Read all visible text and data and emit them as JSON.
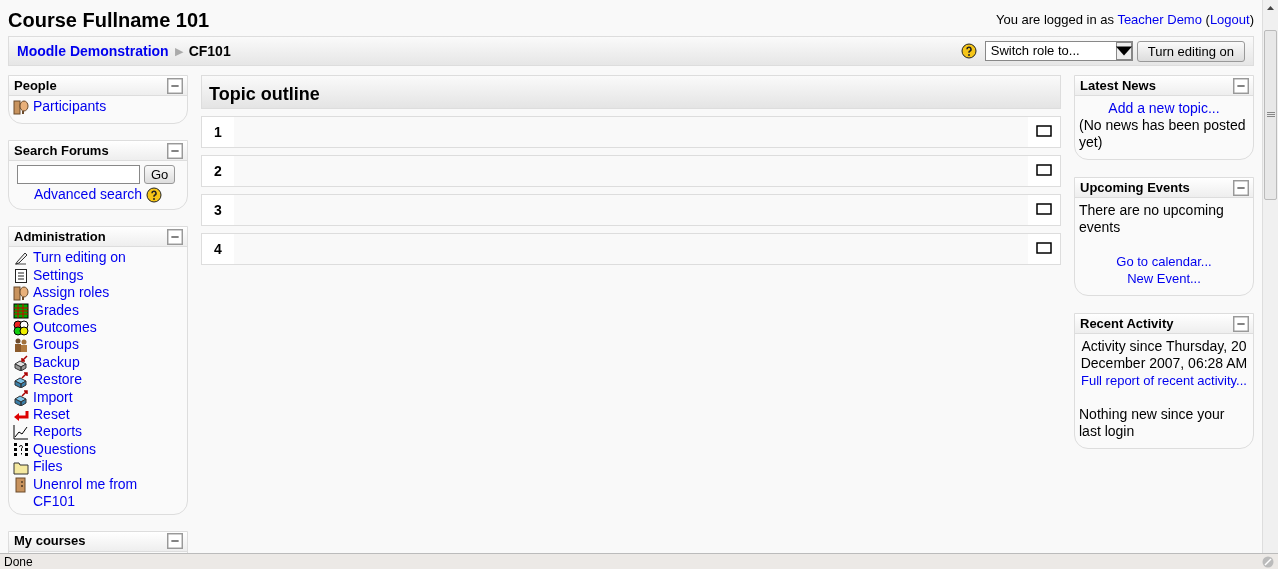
{
  "header": {
    "title": "Course Fullname 101",
    "login_prefix": "You are logged in as",
    "user": "Teacher Demo",
    "logout_open": "(",
    "logout": "Logout",
    "logout_close": ")"
  },
  "navbar": {
    "breadcrumb": [
      {
        "label": "Moodle Demonstration",
        "link": true
      },
      {
        "label": "CF101",
        "link": false
      }
    ],
    "separator": "▶",
    "role_select": "Switch role to...",
    "edit_button": "Turn editing on"
  },
  "left_blocks": [
    {
      "title": "People",
      "items": [
        {
          "label": "Participants"
        }
      ]
    },
    {
      "title": "Search Forums",
      "kind": "search",
      "button": "Go",
      "link": "Advanced search"
    },
    {
      "title": "Administration",
      "items": [
        {
          "label": "Turn editing on"
        },
        {
          "label": "Settings"
        },
        {
          "label": "Assign roles"
        },
        {
          "label": "Grades"
        },
        {
          "label": "Outcomes"
        },
        {
          "label": "Groups"
        },
        {
          "label": "Backup"
        },
        {
          "label": "Restore"
        },
        {
          "label": "Import"
        },
        {
          "label": "Reset"
        },
        {
          "label": "Reports"
        },
        {
          "label": "Questions"
        },
        {
          "label": "Files"
        },
        {
          "label": "Unenrol me from CF101"
        }
      ]
    },
    {
      "title": "My courses"
    }
  ],
  "main": {
    "title": "Topic outline",
    "topics": [
      "1",
      "2",
      "3",
      "4"
    ]
  },
  "right_blocks": [
    {
      "title": "Latest News",
      "lines": [
        {
          "kind": "link",
          "text": "Add a new topic...",
          "center": true
        },
        {
          "kind": "text",
          "text": "(No news has been posted yet)"
        }
      ]
    },
    {
      "title": "Upcoming Events",
      "lines": [
        {
          "kind": "text",
          "text": "There are no upcoming events"
        },
        {
          "kind": "gap"
        },
        {
          "kind": "link",
          "text": "Go to calendar...",
          "center": true
        },
        {
          "kind": "link",
          "text": "New Event...",
          "center": true
        }
      ]
    },
    {
      "title": "Recent Activity",
      "lines": [
        {
          "kind": "text",
          "text": "Activity since Thursday, 20 December 2007, 06:28 AM",
          "center": true
        },
        {
          "kind": "link",
          "text": "Full report of recent activity...",
          "center": true
        },
        {
          "kind": "gap"
        },
        {
          "kind": "text",
          "text": "Nothing new since your last login"
        }
      ]
    }
  ],
  "status_bar": {
    "text": "Done"
  }
}
